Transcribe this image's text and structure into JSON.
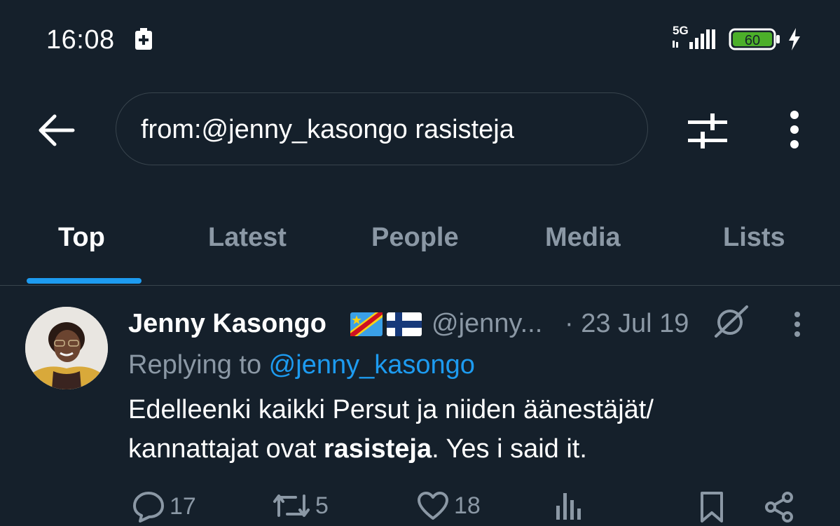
{
  "status_bar": {
    "time": "16:08",
    "network": "5G",
    "battery": "60"
  },
  "search": {
    "query": "from:@jenny_kasongo rasisteja"
  },
  "tabs": [
    {
      "label": "Top",
      "active": true
    },
    {
      "label": "Latest",
      "active": false
    },
    {
      "label": "People",
      "active": false
    },
    {
      "label": "Media",
      "active": false
    },
    {
      "label": "Lists",
      "active": false
    }
  ],
  "tweet": {
    "author_name": "Jenny Kasongo",
    "flags": [
      "flag-cd-icon",
      "flag-fi-icon"
    ],
    "handle": "@jenny...",
    "date": "· 23 Jul 19",
    "replying_prefix": "Replying to ",
    "replying_handle": "@jenny_kasongo",
    "text_line1": "Edelleenki kaikki Persut ja niiden äänestäjät/",
    "text_line2_pre": "kannattajat ovat ",
    "text_line2_bold": "rasisteja",
    "text_line2_post": ". Yes i said it.",
    "replies": "17",
    "retweets": "5",
    "likes": "18"
  },
  "colors": {
    "background": "#15202b",
    "accent": "#1d9bf0",
    "muted": "#8b98a5",
    "border": "#38444d"
  }
}
